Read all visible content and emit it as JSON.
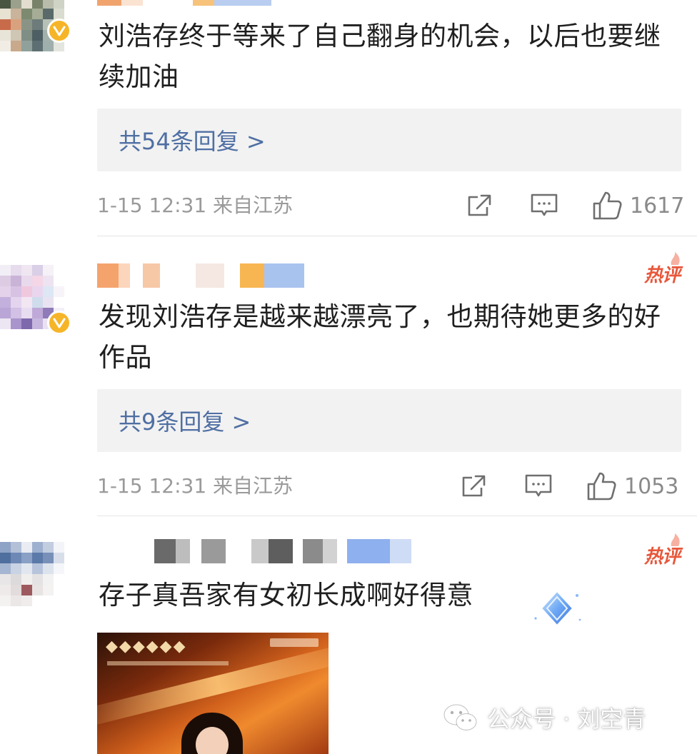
{
  "comments": [
    {
      "text": "刘浩存终于等来了自己翻身的机会，以后也要继续加油",
      "reply_label": "共54条回复 >",
      "time_location": "1-15 12:31 来自江苏",
      "like_count": "1617"
    },
    {
      "hot_label": "热评",
      "text": "发现刘浩存是越来越漂亮了，也期待她更多的好作品",
      "reply_label": "共9条回复 >",
      "time_location": "1-15 12:31 来自江苏",
      "like_count": "1053"
    },
    {
      "hot_label": "热评",
      "text": "存子真吾家有女初长成啊好得意"
    }
  ],
  "watermark": {
    "text": "公众号 · 刘空青"
  },
  "icons": {
    "share": "share-icon",
    "comment": "comment-icon",
    "like": "thumbs-up-icon",
    "verified": "verified-v-icon",
    "wechat": "wechat-icon",
    "hot": "flame-icon"
  },
  "colors": {
    "link": "#4f6fa3",
    "hot": "#e8563a",
    "verified": "#f6b528",
    "meta": "#9a9a9a",
    "reply_bg": "#f2f2f2"
  }
}
